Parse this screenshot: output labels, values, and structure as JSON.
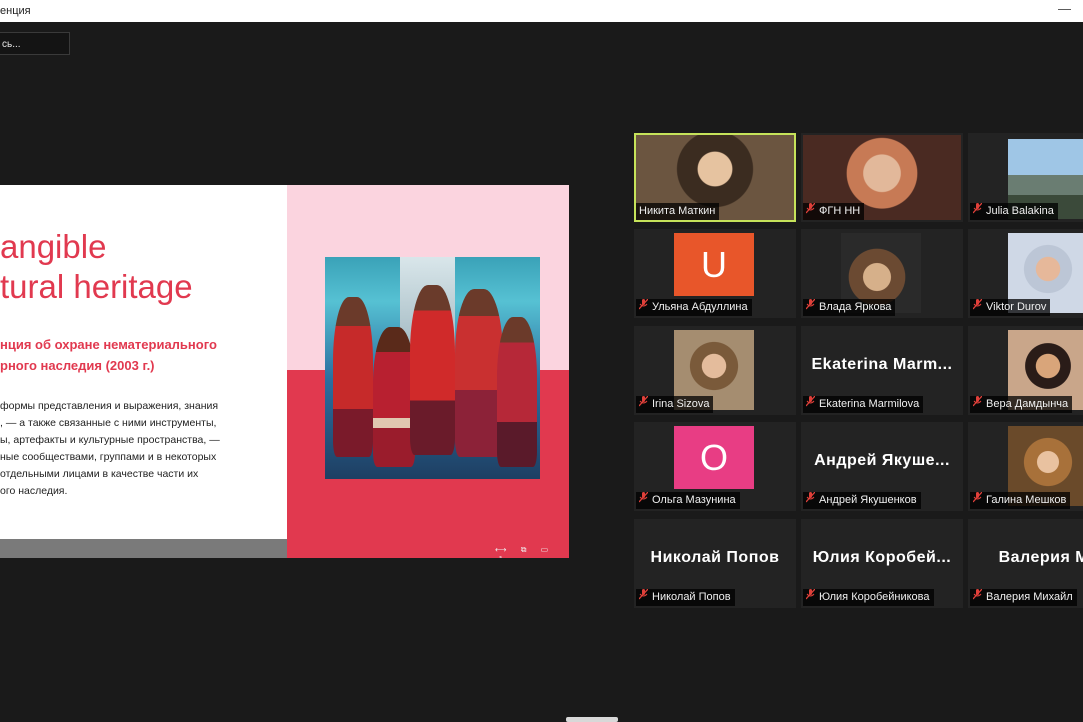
{
  "window": {
    "title": "енция",
    "minimize_glyph": "—"
  },
  "view_button": {
    "label": "сь..."
  },
  "slide": {
    "title_line1": "angible",
    "title_line2": "tural heritage",
    "subtitle_line1": "нция об охране нематериального",
    "subtitle_line2": "рного наследия (2003 г.)",
    "body_lines": [
      "формы представления и выражения, знания",
      ", — а также связанные с ними инструменты,",
      "ы, артефакты и культурные пространства, —",
      "ные сообществами, группами и в некоторых",
      "отдельными лицами в качестве части их",
      "ого наследия."
    ],
    "controls_glyphs": "⟷ ⧉ ▭ ⤢",
    "colors": {
      "accent": "#e1394f",
      "pink": "#fbd4df"
    }
  },
  "participants": [
    {
      "name": "Никита Маткин",
      "muted": false,
      "kind": "video",
      "active": true
    },
    {
      "name": "ФГН НН",
      "muted": true,
      "kind": "video"
    },
    {
      "name": "Julia Balakina",
      "muted": true,
      "kind": "video"
    },
    {
      "name": "Ульяна Абдуллина",
      "muted": true,
      "kind": "avatar",
      "initial": "U",
      "color": "#e8562a"
    },
    {
      "name": "Влада Яркова",
      "muted": true,
      "kind": "video"
    },
    {
      "name": "Viktor Durov",
      "muted": true,
      "kind": "video"
    },
    {
      "name": "Irina Sizova",
      "muted": true,
      "kind": "video"
    },
    {
      "name": "Ekaterina Marmilova",
      "muted": true,
      "kind": "text",
      "display": "Ekaterina  Marm..."
    },
    {
      "name": "Вера Дамдынча",
      "muted": true,
      "kind": "video"
    },
    {
      "name": "Ольга Мазунина",
      "muted": true,
      "kind": "avatar",
      "initial": "O",
      "color": "#e83d84"
    },
    {
      "name": "Андрей Якушенков",
      "muted": true,
      "kind": "text",
      "display": "Андрей  Якуше..."
    },
    {
      "name": "Галина Мешков",
      "muted": true,
      "kind": "video"
    },
    {
      "name": "Николай Попов",
      "muted": true,
      "kind": "text",
      "display": "Николай Попов"
    },
    {
      "name": "Юлия Коробейникова",
      "muted": true,
      "kind": "text",
      "display": "Юлия  Коробей..."
    },
    {
      "name": "Валерия Михайл",
      "muted": true,
      "kind": "text",
      "display": "Валерия  Ми"
    }
  ],
  "icons": {
    "muted": "mic-off-icon"
  }
}
